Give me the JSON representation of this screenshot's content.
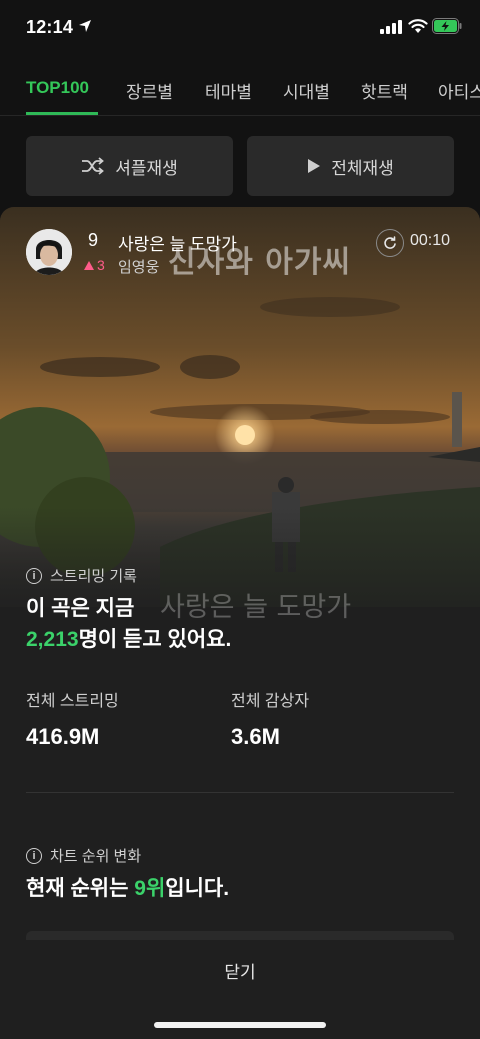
{
  "status_bar": {
    "time": "12:14"
  },
  "tabs": [
    {
      "label": "TOP100",
      "active": true
    },
    {
      "label": "장르별"
    },
    {
      "label": "테마별"
    },
    {
      "label": "시대별"
    },
    {
      "label": "핫트랙"
    },
    {
      "label": "아티스트"
    }
  ],
  "actions": {
    "shuffle_label": "셔플재생",
    "play_all_label": "전체재생"
  },
  "card": {
    "rank": "9",
    "song_title": "사랑은 늘 도망가",
    "rank_change": "3",
    "artist": "임영웅",
    "elapsed": "00:10",
    "art_title": "신사와 아가씨",
    "art_overlay_text": "사랑은 늘 도망가",
    "streaming": {
      "section_label": "스트리밍 기록",
      "line1": "이 곡은 지금",
      "listeners": "2,213",
      "line2_suffix": "명이 듣고 있어요.",
      "total_streams_label": "전체 스트리밍",
      "total_streams_value": "416.9M",
      "total_listeners_label": "전체 감상자",
      "total_listeners_value": "3.6M"
    },
    "chart": {
      "section_label": "차트 순위 변화",
      "prefix": "현재 순위는 ",
      "rank_text": "9위",
      "suffix": "입니다."
    }
  },
  "close_label": "닫기",
  "colors": {
    "accent": "#3bd26a",
    "up": "#ff5c8a",
    "background": "#121212",
    "card": "#1f1f1f"
  }
}
